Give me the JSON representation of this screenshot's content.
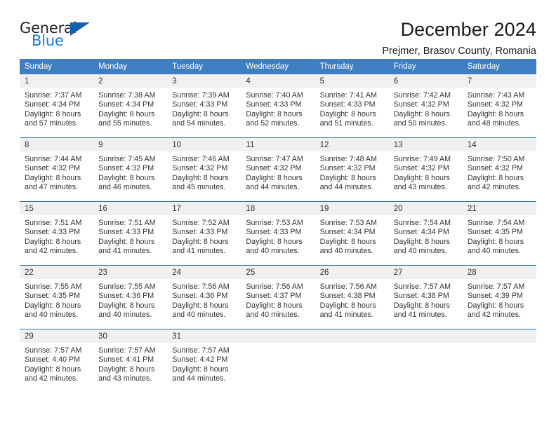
{
  "brand": {
    "name_top": "General",
    "name_bottom": "Blue",
    "triangle_color": "#1261a8",
    "blue_color": "#1e7bc4"
  },
  "header": {
    "title": "December 2024",
    "subtitle": "Prejmer, Brasov County, Romania"
  },
  "colors": {
    "header_blue": "#3f7fc1",
    "row_divider": "#2f6da8",
    "day_band": "#f0f0f0",
    "text": "#333333"
  },
  "weekday_headers": [
    "Sunday",
    "Monday",
    "Tuesday",
    "Wednesday",
    "Thursday",
    "Friday",
    "Saturday"
  ],
  "weeks": [
    [
      {
        "day": "1",
        "sunrise": "Sunrise: 7:37 AM",
        "sunset": "Sunset: 4:34 PM",
        "daylight_1": "Daylight: 8 hours",
        "daylight_2": "and 57 minutes."
      },
      {
        "day": "2",
        "sunrise": "Sunrise: 7:38 AM",
        "sunset": "Sunset: 4:34 PM",
        "daylight_1": "Daylight: 8 hours",
        "daylight_2": "and 55 minutes."
      },
      {
        "day": "3",
        "sunrise": "Sunrise: 7:39 AM",
        "sunset": "Sunset: 4:33 PM",
        "daylight_1": "Daylight: 8 hours",
        "daylight_2": "and 54 minutes."
      },
      {
        "day": "4",
        "sunrise": "Sunrise: 7:40 AM",
        "sunset": "Sunset: 4:33 PM",
        "daylight_1": "Daylight: 8 hours",
        "daylight_2": "and 52 minutes."
      },
      {
        "day": "5",
        "sunrise": "Sunrise: 7:41 AM",
        "sunset": "Sunset: 4:33 PM",
        "daylight_1": "Daylight: 8 hours",
        "daylight_2": "and 51 minutes."
      },
      {
        "day": "6",
        "sunrise": "Sunrise: 7:42 AM",
        "sunset": "Sunset: 4:32 PM",
        "daylight_1": "Daylight: 8 hours",
        "daylight_2": "and 50 minutes."
      },
      {
        "day": "7",
        "sunrise": "Sunrise: 7:43 AM",
        "sunset": "Sunset: 4:32 PM",
        "daylight_1": "Daylight: 8 hours",
        "daylight_2": "and 48 minutes."
      }
    ],
    [
      {
        "day": "8",
        "sunrise": "Sunrise: 7:44 AM",
        "sunset": "Sunset: 4:32 PM",
        "daylight_1": "Daylight: 8 hours",
        "daylight_2": "and 47 minutes."
      },
      {
        "day": "9",
        "sunrise": "Sunrise: 7:45 AM",
        "sunset": "Sunset: 4:32 PM",
        "daylight_1": "Daylight: 8 hours",
        "daylight_2": "and 46 minutes."
      },
      {
        "day": "10",
        "sunrise": "Sunrise: 7:46 AM",
        "sunset": "Sunset: 4:32 PM",
        "daylight_1": "Daylight: 8 hours",
        "daylight_2": "and 45 minutes."
      },
      {
        "day": "11",
        "sunrise": "Sunrise: 7:47 AM",
        "sunset": "Sunset: 4:32 PM",
        "daylight_1": "Daylight: 8 hours",
        "daylight_2": "and 44 minutes."
      },
      {
        "day": "12",
        "sunrise": "Sunrise: 7:48 AM",
        "sunset": "Sunset: 4:32 PM",
        "daylight_1": "Daylight: 8 hours",
        "daylight_2": "and 44 minutes."
      },
      {
        "day": "13",
        "sunrise": "Sunrise: 7:49 AM",
        "sunset": "Sunset: 4:32 PM",
        "daylight_1": "Daylight: 8 hours",
        "daylight_2": "and 43 minutes."
      },
      {
        "day": "14",
        "sunrise": "Sunrise: 7:50 AM",
        "sunset": "Sunset: 4:32 PM",
        "daylight_1": "Daylight: 8 hours",
        "daylight_2": "and 42 minutes."
      }
    ],
    [
      {
        "day": "15",
        "sunrise": "Sunrise: 7:51 AM",
        "sunset": "Sunset: 4:33 PM",
        "daylight_1": "Daylight: 8 hours",
        "daylight_2": "and 42 minutes."
      },
      {
        "day": "16",
        "sunrise": "Sunrise: 7:51 AM",
        "sunset": "Sunset: 4:33 PM",
        "daylight_1": "Daylight: 8 hours",
        "daylight_2": "and 41 minutes."
      },
      {
        "day": "17",
        "sunrise": "Sunrise: 7:52 AM",
        "sunset": "Sunset: 4:33 PM",
        "daylight_1": "Daylight: 8 hours",
        "daylight_2": "and 41 minutes."
      },
      {
        "day": "18",
        "sunrise": "Sunrise: 7:53 AM",
        "sunset": "Sunset: 4:33 PM",
        "daylight_1": "Daylight: 8 hours",
        "daylight_2": "and 40 minutes."
      },
      {
        "day": "19",
        "sunrise": "Sunrise: 7:53 AM",
        "sunset": "Sunset: 4:34 PM",
        "daylight_1": "Daylight: 8 hours",
        "daylight_2": "and 40 minutes."
      },
      {
        "day": "20",
        "sunrise": "Sunrise: 7:54 AM",
        "sunset": "Sunset: 4:34 PM",
        "daylight_1": "Daylight: 8 hours",
        "daylight_2": "and 40 minutes."
      },
      {
        "day": "21",
        "sunrise": "Sunrise: 7:54 AM",
        "sunset": "Sunset: 4:35 PM",
        "daylight_1": "Daylight: 8 hours",
        "daylight_2": "and 40 minutes."
      }
    ],
    [
      {
        "day": "22",
        "sunrise": "Sunrise: 7:55 AM",
        "sunset": "Sunset: 4:35 PM",
        "daylight_1": "Daylight: 8 hours",
        "daylight_2": "and 40 minutes."
      },
      {
        "day": "23",
        "sunrise": "Sunrise: 7:55 AM",
        "sunset": "Sunset: 4:36 PM",
        "daylight_1": "Daylight: 8 hours",
        "daylight_2": "and 40 minutes."
      },
      {
        "day": "24",
        "sunrise": "Sunrise: 7:56 AM",
        "sunset": "Sunset: 4:36 PM",
        "daylight_1": "Daylight: 8 hours",
        "daylight_2": "and 40 minutes."
      },
      {
        "day": "25",
        "sunrise": "Sunrise: 7:56 AM",
        "sunset": "Sunset: 4:37 PM",
        "daylight_1": "Daylight: 8 hours",
        "daylight_2": "and 40 minutes."
      },
      {
        "day": "26",
        "sunrise": "Sunrise: 7:56 AM",
        "sunset": "Sunset: 4:38 PM",
        "daylight_1": "Daylight: 8 hours",
        "daylight_2": "and 41 minutes."
      },
      {
        "day": "27",
        "sunrise": "Sunrise: 7:57 AM",
        "sunset": "Sunset: 4:38 PM",
        "daylight_1": "Daylight: 8 hours",
        "daylight_2": "and 41 minutes."
      },
      {
        "day": "28",
        "sunrise": "Sunrise: 7:57 AM",
        "sunset": "Sunset: 4:39 PM",
        "daylight_1": "Daylight: 8 hours",
        "daylight_2": "and 42 minutes."
      }
    ],
    [
      {
        "day": "29",
        "sunrise": "Sunrise: 7:57 AM",
        "sunset": "Sunset: 4:40 PM",
        "daylight_1": "Daylight: 8 hours",
        "daylight_2": "and 42 minutes."
      },
      {
        "day": "30",
        "sunrise": "Sunrise: 7:57 AM",
        "sunset": "Sunset: 4:41 PM",
        "daylight_1": "Daylight: 8 hours",
        "daylight_2": "and 43 minutes."
      },
      {
        "day": "31",
        "sunrise": "Sunrise: 7:57 AM",
        "sunset": "Sunset: 4:42 PM",
        "daylight_1": "Daylight: 8 hours",
        "daylight_2": "and 44 minutes."
      },
      {
        "day": "",
        "sunrise": "",
        "sunset": "",
        "daylight_1": "",
        "daylight_2": ""
      },
      {
        "day": "",
        "sunrise": "",
        "sunset": "",
        "daylight_1": "",
        "daylight_2": ""
      },
      {
        "day": "",
        "sunrise": "",
        "sunset": "",
        "daylight_1": "",
        "daylight_2": ""
      },
      {
        "day": "",
        "sunrise": "",
        "sunset": "",
        "daylight_1": "",
        "daylight_2": ""
      }
    ]
  ]
}
